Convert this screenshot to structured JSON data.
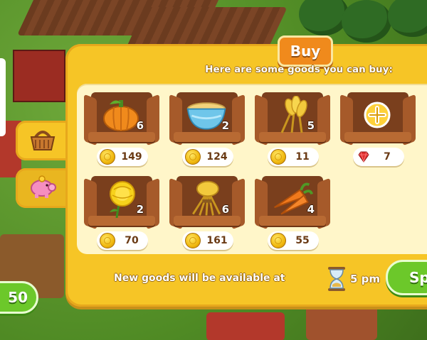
{
  "dialog": {
    "title": "Buy",
    "subtitle": "Here are some goods you can buy:",
    "footer_text": "New goods will be available at",
    "time": "5 pm",
    "speed_button_label": "Sp"
  },
  "side_tabs": [
    {
      "name": "basket",
      "icon": "basket-icon",
      "active": true
    },
    {
      "name": "piggy-bank",
      "icon": "piggy-bank-icon",
      "active": false
    }
  ],
  "left_button_label": "50",
  "goods": [
    {
      "item": "pumpkin",
      "icon": "pumpkin-icon",
      "qty": "6",
      "price": "149",
      "currency": "coin"
    },
    {
      "item": "cornflakes",
      "icon": "cornflakes-bowl-icon",
      "qty": "2",
      "price": "124",
      "currency": "coin"
    },
    {
      "item": "wheat",
      "icon": "wheat-icon",
      "qty": "5",
      "price": "11",
      "currency": "coin"
    },
    {
      "item": "add-slot",
      "icon": "plus-icon",
      "qty": "",
      "price": "7",
      "currency": "gem"
    },
    {
      "item": "marigold",
      "icon": "marigold-flower-icon",
      "qty": "2",
      "price": "70",
      "currency": "coin"
    },
    {
      "item": "wheat-bundle",
      "icon": "wheat-bundle-icon",
      "qty": "6",
      "price": "161",
      "currency": "coin"
    },
    {
      "item": "carrot",
      "icon": "carrot-icon",
      "qty": "4",
      "price": "55",
      "currency": "coin"
    }
  ],
  "colors": {
    "panel": "#f6c526",
    "title_tab": "#f08a1c",
    "button_green": "#6cc82a",
    "crate_wood": "#a65a2a"
  }
}
